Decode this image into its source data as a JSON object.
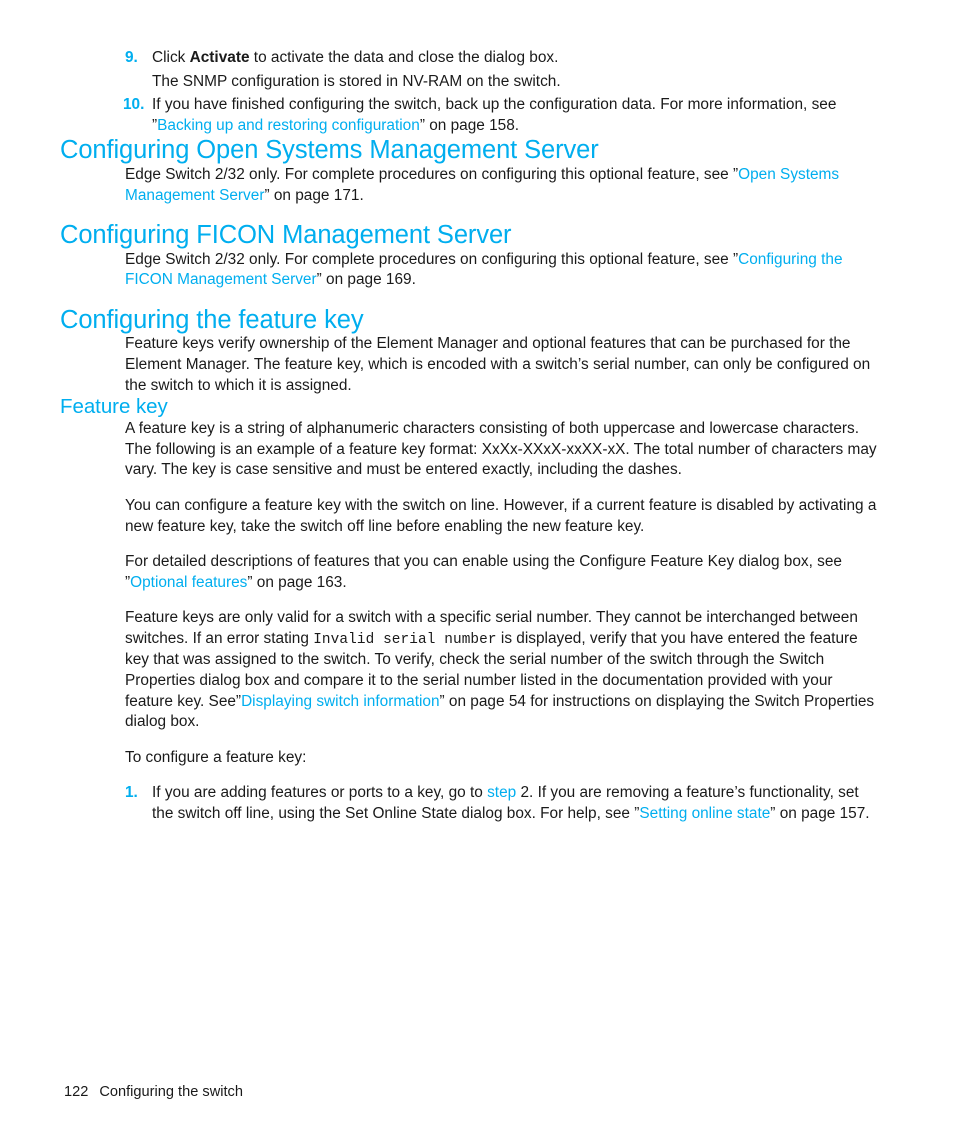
{
  "colors": {
    "accent": "#00AEEF",
    "body_text": "#1a1a1a",
    "page_background": "#ffffff"
  },
  "steps_top": [
    {
      "number": "9.",
      "text_before_bold": "Click ",
      "bold": "Activate",
      "text_after_bold": " to activate the data and close the dialog box.",
      "continuation": "The SNMP configuration is stored in NV-RAM on the switch."
    },
    {
      "number": "10.",
      "text_part1": "If you have finished configuring the switch, back up the configuration data. For more information, see ”",
      "link": "Backing up and restoring configuration",
      "text_part2": "” on page 158."
    }
  ],
  "sections": [
    {
      "heading": "Configuring Open Systems Management Server",
      "paragraph_part1": "Edge Switch 2/32 only. For complete procedures on configuring this optional feature, see ”",
      "link": "Open Systems Management Server",
      "paragraph_part2": "” on page 171."
    },
    {
      "heading": "Configuring FICON Management Server",
      "paragraph_part1": "Edge Switch 2/32 only. For complete procedures on configuring this optional feature, see ”",
      "link": "Configuring the FICON Management Server",
      "paragraph_part2": "” on page 169."
    }
  ],
  "feature_key_section": {
    "heading": "Configuring the feature key",
    "intro_paragraph": "Feature keys verify ownership of the Element Manager and optional features that can be purchased for the Element Manager. The feature key, which is encoded with a switch’s serial number, can only be configured on the switch to which it is assigned.",
    "subheading": "Feature key",
    "paragraph_1": "A feature key is a string of alphanumeric characters consisting of both uppercase and lowercase characters. The following is an example of a feature key format: XxXx-XXxX-xxXX-xX. The total number of characters may vary. The key is case sensitive and must be entered exactly, including the dashes.",
    "paragraph_2": "You can configure a feature key with the switch on line. However, if a current feature is disabled by activating a new feature key, take the switch off line before enabling the new feature key.",
    "paragraph_3_part1": "For detailed descriptions of features that you can enable using the Configure Feature Key dialog box, see ”",
    "paragraph_3_link": "Optional features",
    "paragraph_3_part2": "” on page 163.",
    "paragraph_4_part1": "Feature keys are only valid for a switch with a specific serial number. They cannot be interchanged between switches. If an error stating ",
    "paragraph_4_mono": "Invalid serial number",
    "paragraph_4_part2": " is displayed, verify that you have entered the feature key that was assigned to the switch. To verify, check the serial number of the switch through the Switch Properties dialog box and compare it to the serial number listed in the documentation provided with your feature key. See”",
    "paragraph_4_link": "Displaying switch information",
    "paragraph_4_part3": "” on page 54 for instructions on displaying the Switch Properties dialog box.",
    "paragraph_5": "To configure a feature key:",
    "step": {
      "number": "1.",
      "text_part1": "If you are adding features or ports to a key, go to ",
      "link_step": "step",
      "text_part2": " 2. If you are removing a feature’s functionality, set the switch off line, using the Set Online State dialog box. For help, see ”",
      "link_setting": "Setting online state",
      "text_part3": "” on page 157."
    }
  },
  "footer": {
    "page_number": "122",
    "chapter_title": "Configuring the switch"
  }
}
